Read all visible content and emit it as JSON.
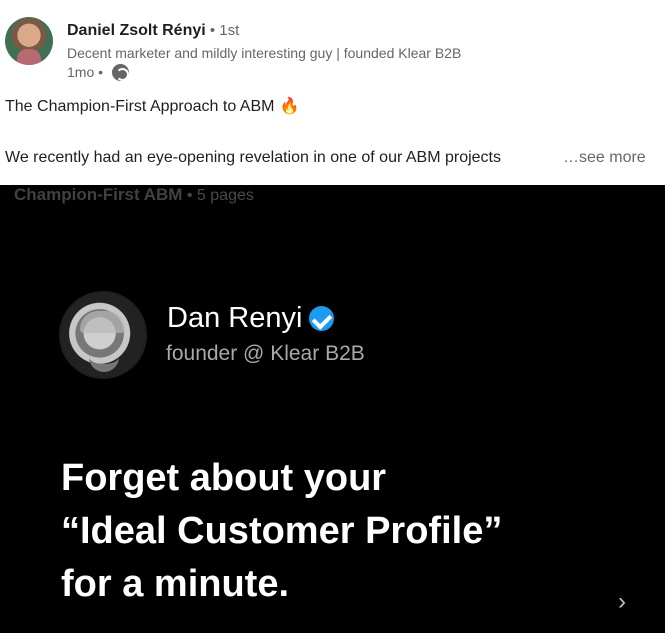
{
  "post": {
    "author_name": "Daniel Zsolt Rényi",
    "degree": " • 1st",
    "headline": "Decent marketer and mildly interesting guy | founded Klear B2B",
    "time": "1mo •",
    "visibility_icon": "globe-icon",
    "title": "The Champion-First Approach to ABM",
    "title_emoji": "🔥",
    "body_preview": "We recently had an eye-opening revelation in one of our ABM projects",
    "see_more": "…see more"
  },
  "document": {
    "name": "Champion-First ABM",
    "separator": " • ",
    "pages": "5 pages"
  },
  "slide": {
    "name": "Dan Renyi",
    "role": "founder @ Klear B2B",
    "quote_line1": "Forget about your",
    "quote_line2": "“Ideal Customer Profile”",
    "quote_line3": "for a minute.",
    "next_icon": "chevron-right-icon",
    "next_label": "›"
  },
  "colors": {
    "verified": "#1d9bf0",
    "carousel_bg": "#000000",
    "secondary_text": "#666666"
  }
}
